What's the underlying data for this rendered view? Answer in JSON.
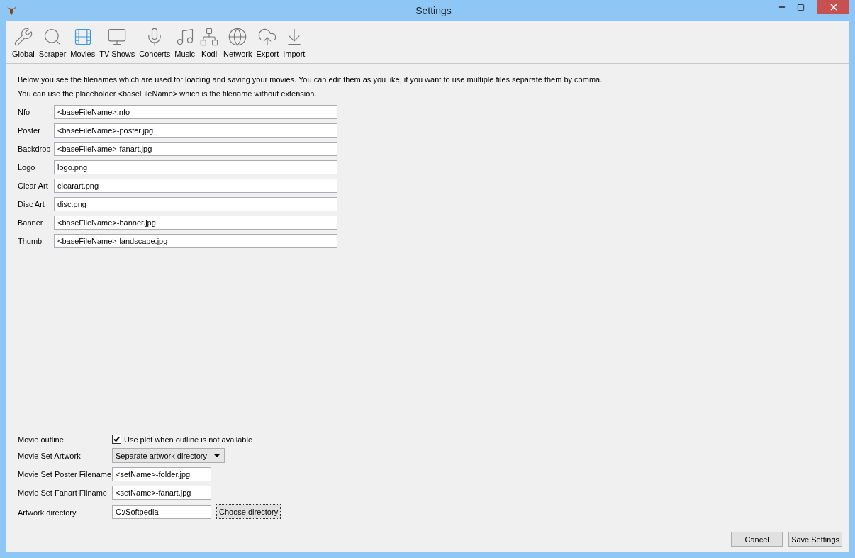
{
  "window": {
    "title": "Settings"
  },
  "toolbar": [
    {
      "label": "Global",
      "selected": false
    },
    {
      "label": "Scraper",
      "selected": false
    },
    {
      "label": "Movies",
      "selected": true
    },
    {
      "label": "TV Shows",
      "selected": false
    },
    {
      "label": "Concerts",
      "selected": false
    },
    {
      "label": "Music",
      "selected": false
    },
    {
      "label": "Kodi",
      "selected": false
    },
    {
      "label": "Network",
      "selected": false
    },
    {
      "label": "Export",
      "selected": false
    },
    {
      "label": "Import",
      "selected": false
    }
  ],
  "intro": [
    "Below you see the filenames which are used for loading and saving your movies. You can edit them as you like, if you want to use multiple files separate them by comma.",
    "You can use the placeholder <baseFileName> which is the filename without extension."
  ],
  "files": [
    {
      "label": "Nfo",
      "value": "<baseFileName>.nfo"
    },
    {
      "label": "Poster",
      "value": "<baseFileName>-poster.jpg"
    },
    {
      "label": "Backdrop",
      "value": "<baseFileName>-fanart.jpg"
    },
    {
      "label": "Logo",
      "value": "logo.png"
    },
    {
      "label": "Clear Art",
      "value": "clearart.png"
    },
    {
      "label": "Disc Art",
      "value": "disc.png"
    },
    {
      "label": "Banner",
      "value": "<baseFileName>-banner.jpg"
    },
    {
      "label": "Thumb",
      "value": "<baseFileName>-landscape.jpg"
    }
  ],
  "options": [
    {
      "kind": "checkbox",
      "label": "Movie outline",
      "text": "Use plot when outline is not available",
      "checked": true
    },
    {
      "kind": "dropdown",
      "label": "Movie Set Artwork",
      "value": "Separate artwork directory"
    },
    {
      "kind": "field",
      "label": "Movie Set Poster Filename",
      "value": "<setName>-folder.jpg"
    },
    {
      "kind": "field",
      "label": "Movie Set Fanart Filname",
      "value": "<setName>-fanart.jpg"
    },
    {
      "kind": "directory",
      "label": "Artwork directory",
      "value": "C:/Softpedia",
      "button": "Choose directory"
    }
  ],
  "buttons": [
    "Cancel",
    "Save Settings"
  ]
}
